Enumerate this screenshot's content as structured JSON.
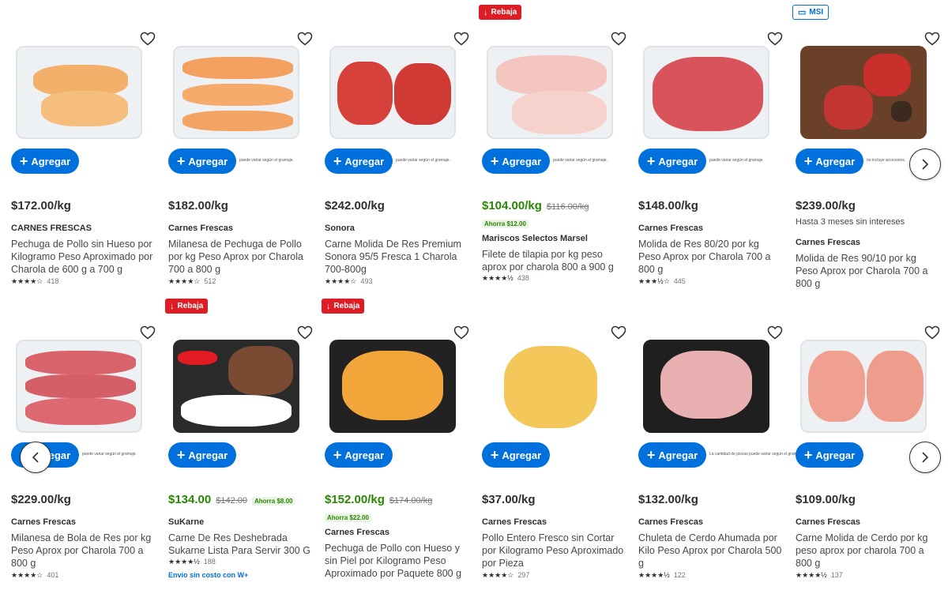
{
  "add_label": "Agregar",
  "products": [
    {
      "flag": "",
      "flag_type": "",
      "price": "$172.00/kg",
      "price_green": false,
      "was": "",
      "save": "",
      "promo": "",
      "brand": "CARNES FRESCAS",
      "title": "Pechuga de Pollo sin Hueso por Kilogramo Peso Aproximado por Charola de 600 g a 700 g",
      "rating_count": "418",
      "stars": "★★★★☆",
      "disclaimer": "",
      "ship": ""
    },
    {
      "flag": "",
      "flag_type": "",
      "price": "$182.00/kg",
      "price_green": false,
      "was": "",
      "save": "",
      "promo": "",
      "brand": "Carnes Frescas",
      "title": "Milanesa de Pechuga de Pollo por kg Peso Aprox por Charola 700 a 800 g",
      "rating_count": "512",
      "stars": "★★★★☆",
      "disclaimer": "puede variar según el gramaje.",
      "ship": ""
    },
    {
      "flag": "",
      "flag_type": "",
      "price": "$242.00/kg",
      "price_green": false,
      "was": "",
      "save": "",
      "promo": "",
      "brand": "Sonora",
      "title": "Carne Molida De Res Premium Sonora 95/5 Fresca 1 Charola 700-800g",
      "rating_count": "493",
      "stars": "★★★★☆",
      "disclaimer": "puede variar según el gramaje.",
      "ship": ""
    },
    {
      "flag": "Rebaja",
      "flag_type": "red",
      "price": "$104.00/kg",
      "price_green": true,
      "was": "$116.00/kg",
      "save": "Ahorra $12.00",
      "promo": "",
      "brand": "Mariscos Selectos Marsel",
      "title": "Filete de tilapia por kg peso aprox por charola 800 a 900 g",
      "rating_count": "438",
      "stars": "★★★★½",
      "disclaimer": "puede variar según el gramaje.",
      "ship": ""
    },
    {
      "flag": "",
      "flag_type": "",
      "price": "$148.00/kg",
      "price_green": false,
      "was": "",
      "save": "",
      "promo": "",
      "brand": "Carnes Frescas",
      "title": "Molida de Res 80/20 por kg Peso Aprox por Charola 700 a 800 g",
      "rating_count": "445",
      "stars": "★★★½☆",
      "disclaimer": "puede variar según el gramaje.",
      "ship": ""
    },
    {
      "flag": "MSI",
      "flag_type": "msi",
      "price": "$239.00/kg",
      "price_green": false,
      "was": "",
      "save": "",
      "promo": "Hasta 3 meses sin intereses",
      "brand": "Carnes Frescas",
      "title": "Molida de Res 90/10 por kg Peso Aprox por Charola 700 a 800 g",
      "rating_count": "",
      "stars": "",
      "disclaimer": "no incluye accesorios.",
      "ship": ""
    },
    {
      "flag": "",
      "flag_type": "",
      "price": "$229.00/kg",
      "price_green": false,
      "was": "",
      "save": "",
      "promo": "",
      "brand": "Carnes Frescas",
      "title": "Milanesa de Bola de Res por kg Peso Aprox por Charola 700 a 800 g",
      "rating_count": "401",
      "stars": "★★★★☆",
      "disclaimer": "puede variar según el gramaje.",
      "ship": ""
    },
    {
      "flag": "Rebaja",
      "flag_type": "red",
      "price": "$134.00",
      "price_green": true,
      "was": "$142.00",
      "save": "Ahorra $8.00",
      "promo": "",
      "brand": "SuKarne",
      "title": "Carne De Res Deshebrada Sukarne Lista Para Servir 300 G",
      "rating_count": "188",
      "stars": "★★★★½",
      "disclaimer": "",
      "ship": "Envío sin costo con W+"
    },
    {
      "flag": "Rebaja",
      "flag_type": "red",
      "price": "$152.00/kg",
      "price_green": true,
      "was": "$174.00/kg",
      "save": "Ahorra $22.00",
      "promo": "",
      "brand": "Carnes Frescas",
      "title": "Pechuga de Pollo con Hueso y sin Piel por Kilogramo Peso Aproximado por Paquete 800 g",
      "rating_count": "",
      "stars": "",
      "disclaimer": "",
      "ship": ""
    },
    {
      "flag": "",
      "flag_type": "",
      "price": "$37.00/kg",
      "price_green": false,
      "was": "",
      "save": "",
      "promo": "",
      "brand": "Carnes Frescas",
      "title": "Pollo Entero Fresco sin Cortar por Kilogramo Peso Aproximado por Pieza",
      "rating_count": "297",
      "stars": "★★★★☆",
      "disclaimer": "",
      "ship": ""
    },
    {
      "flag": "",
      "flag_type": "",
      "price": "$132.00/kg",
      "price_green": false,
      "was": "",
      "save": "",
      "promo": "",
      "brand": "Carnes Frescas",
      "title": "Chuleta de Cerdo Ahumada por Kilo Peso Aprox por Charola 500 g",
      "rating_count": "122",
      "stars": "★★★★½",
      "disclaimer": "La cantidad de piezas puede variar según el gramaje.",
      "ship": ""
    },
    {
      "flag": "",
      "flag_type": "",
      "price": "$109.00/kg",
      "price_green": false,
      "was": "",
      "save": "",
      "promo": "",
      "brand": "Carnes Frescas",
      "title": "Carne Molida de Cerdo por kg peso aprox por charola 700 a 800 g",
      "rating_count": "137",
      "stars": "★★★★½",
      "disclaimer": "",
      "ship": ""
    }
  ],
  "colors": {
    "accent": "#0071dc",
    "sale": "#de1c24",
    "green": "#2a8703"
  }
}
